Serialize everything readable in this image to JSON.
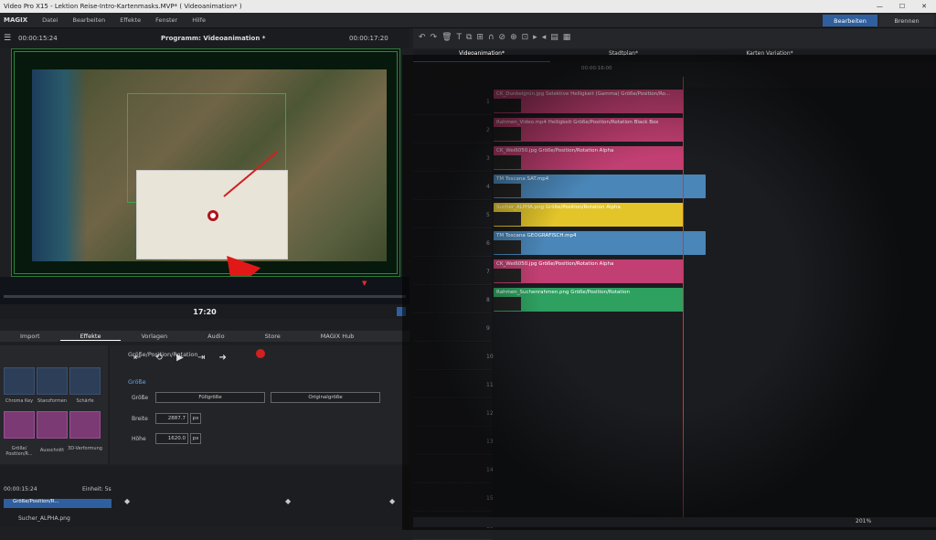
{
  "window": {
    "title": "Video Pro X15 - Lektion Reise-Intro-Kartenmasks.MVP* ( Videoanimation* )"
  },
  "menu": {
    "logo": "MAGIX",
    "items": [
      "Datei",
      "Bearbeiten",
      "Effekte",
      "Fenster",
      "Hilfe"
    ],
    "mode_edit": "Bearbeiten",
    "mode_burn": "Brennen"
  },
  "preview": {
    "time_left": "00:00:15:24",
    "program": "Programm: Videoanimation *",
    "time_right": "00:00:17:20",
    "position": "17:20"
  },
  "browser": {
    "tabs": [
      "Import",
      "Effekte",
      "Vorlagen",
      "Audio",
      "Store",
      "MAGIX Hub"
    ]
  },
  "effects": {
    "items": [
      "Chroma Key",
      "Stanzformen",
      "Schärfe",
      "Größe/ Position/R...",
      "Ausschnitt",
      "3D-Verformung"
    ]
  },
  "props": {
    "header": "Größe/Position/Rotation",
    "section": "Größe",
    "size_label": "Größe",
    "btn_fill": "Füllgröße",
    "btn_orig": "Originalgröße",
    "width_label": "Breite",
    "width_val": "2887.7",
    "height_label": "Höhe",
    "height_val": "1620.0",
    "unit": "px"
  },
  "keyframes": {
    "time": "00:00:15:24",
    "unit_label": "Einheit: 5s",
    "track_label": "Größe/Position/R...",
    "file": "Sucher_ALPHA.png"
  },
  "timeline": {
    "tabs": [
      "Videoanimation*",
      "Stadtplan*",
      "Karten Variation*"
    ],
    "ruler_time": "00:00:16:00",
    "clips": [
      {
        "label": "CK_Dunkelgrün.jpg  Selektive Helligkeit (Gamma)  Größe/Position/Ro...",
        "color": "#c13f72"
      },
      {
        "label": "Rahmen_Video.mp4  Helligkeit  Größe/Position/Rotation Black Box",
        "color": "#c13f72"
      },
      {
        "label": "CK_Weiß050.jpg  Größe/Position/Rotation Alpha",
        "color": "#c13f72"
      },
      {
        "label": "TM Toscana SAT.mp4",
        "color": "#4a86b8"
      },
      {
        "label": "Sucher_ALPHA.png  Größe/Position/Rotation Alpha",
        "color": "#e3c52a"
      },
      {
        "label": "TM Toscana GEOGRAFISCH.mp4",
        "color": "#4a86b8"
      },
      {
        "label": "CK_Weiß050.jpg  Größe/Position/Rotation Alpha",
        "color": "#c13f72"
      },
      {
        "label": "Rahmen_Suchenrahmen.png  Größe/Position/Rotation",
        "color": "#2ea060"
      }
    ],
    "track_numbers": [
      "1",
      "2",
      "3",
      "4",
      "5",
      "6",
      "7",
      "8",
      "9",
      "10",
      "11",
      "12",
      "13",
      "14",
      "15",
      "16"
    ],
    "zoom": "201%"
  }
}
